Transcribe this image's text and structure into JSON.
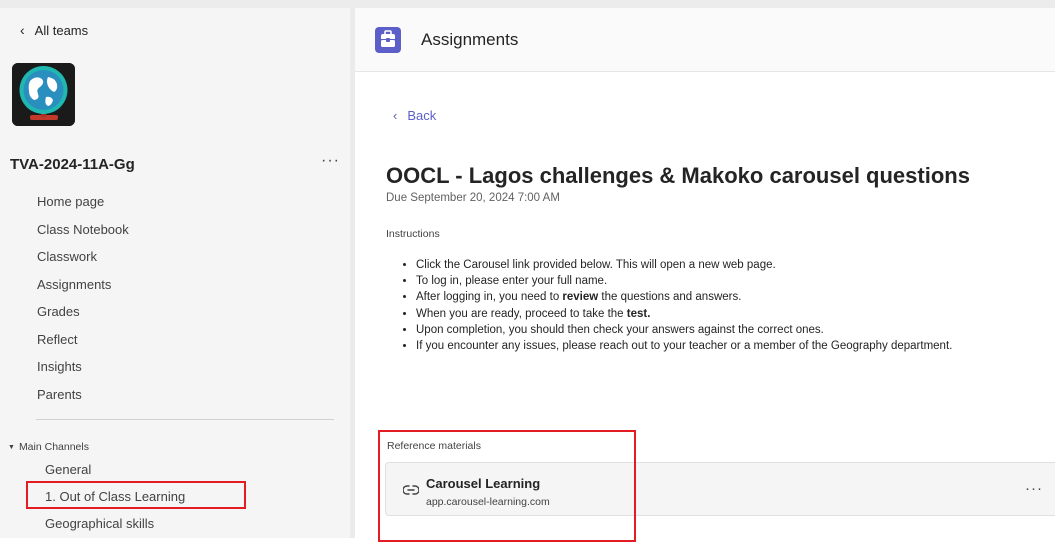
{
  "sidebar": {
    "back_label": "All teams",
    "team_name": "TVA-2024-11A-Gg",
    "more_label": "···",
    "nav_items": [
      "Home page",
      "Class Notebook",
      "Classwork",
      "Assignments",
      "Grades",
      "Reflect",
      "Insights",
      "Parents"
    ],
    "channels_header": "Main Channels",
    "channels": [
      "General",
      "1. Out of Class Learning",
      "Geographical skills"
    ]
  },
  "header": {
    "app_title": "Assignments",
    "app_color": "#5b5fc7"
  },
  "assignment": {
    "back_label": "Back",
    "title": "OOCL - Lagos challenges & Makoko carousel questions",
    "due": "Due September 20, 2024 7:00 AM",
    "instructions_label": "Instructions",
    "instructions": [
      {
        "pre": "Click the Carousel link provided below. This will open a new web page.",
        "bold": "",
        "post": ""
      },
      {
        "pre": "To log in, please enter your full name.",
        "bold": "",
        "post": ""
      },
      {
        "pre": "After logging in, you need to ",
        "bold": "review",
        "post": " the questions and answers."
      },
      {
        "pre": "When you are ready, proceed to take the ",
        "bold": "test.",
        "post": ""
      },
      {
        "pre": "Upon completion, you should then check your answers against the correct ones.",
        "bold": "",
        "post": ""
      },
      {
        "pre": "If you encounter any issues, please reach out to your teacher or a member of the Geography department.",
        "bold": "",
        "post": ""
      }
    ],
    "reference_label": "Reference materials",
    "reference": {
      "name": "Carousel Learning",
      "url": "app.carousel-learning.com",
      "more_label": "···"
    }
  },
  "colors": {
    "highlight": "#e31b23",
    "accent": "#5b5fc7"
  }
}
